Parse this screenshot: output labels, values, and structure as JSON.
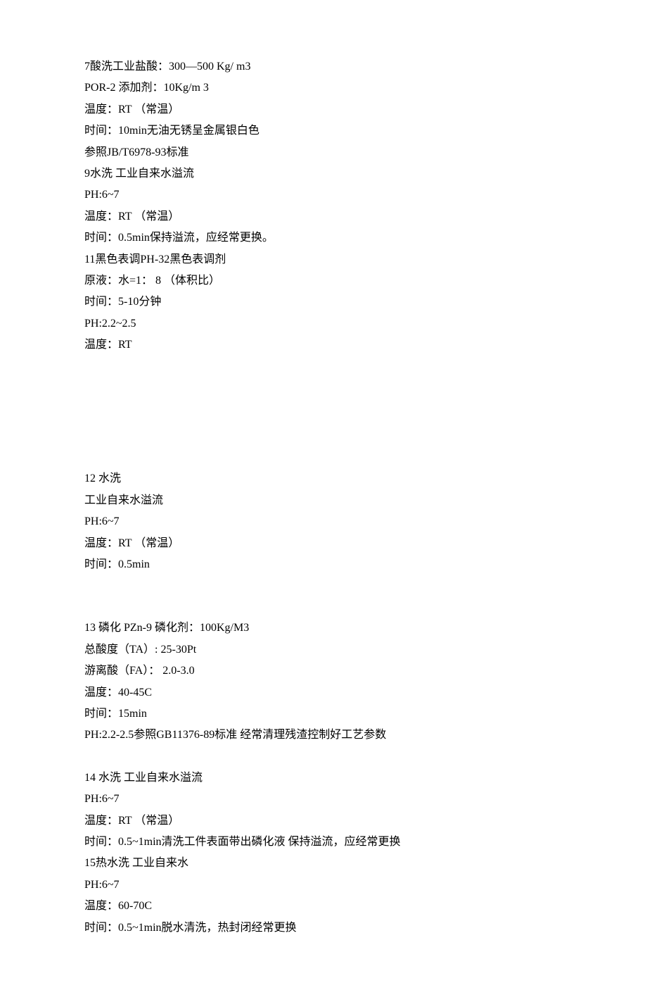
{
  "section7": {
    "lines": [
      "7酸洗工业盐酸：300—500 Kg/ m3",
      "POR-2 添加剂：10Kg/m 3",
      "温度：RT （常温）",
      "时间：10min无油无锈呈金属银白色",
      "参照JB/T6978-93标准",
      "9水洗 工业自来水溢流",
      "PH:6~7",
      "温度：RT （常温）",
      "时间：0.5min保持溢流，应经常更换。",
      "11黑色表调PH-32黑色表调剂",
      "原液：水=1： 8 （体积比）",
      "时间：5-10分钟",
      "PH:2.2~2.5",
      "温度：RT"
    ]
  },
  "section12": {
    "lines": [
      "12 水洗",
      "工业自来水溢流",
      "PH:6~7",
      "温度：RT （常温）",
      "时间：0.5min"
    ]
  },
  "section13": {
    "lines": [
      "13 磷化 PZn-9 磷化剂：100Kg/M3",
      "总酸度（TA）: 25-30Pt",
      "游离酸（FA）： 2.0-3.0",
      "温度：40-45C",
      "时间：15min",
      "PH:2.2-2.5参照GB11376-89标准 经常清理残渣控制好工艺参数"
    ]
  },
  "section14": {
    "lines": [
      "14 水洗 工业自来水溢流",
      "PH:6~7",
      "温度：RT （常温）",
      "时间：0.5~1min清洗工件表面带出磷化液 保持溢流，应经常更换",
      "15热水洗 工业自来水",
      "PH:6~7",
      "温度：60-70C",
      "时间：0.5~1min脱水清洗，热封闭经常更换"
    ]
  }
}
